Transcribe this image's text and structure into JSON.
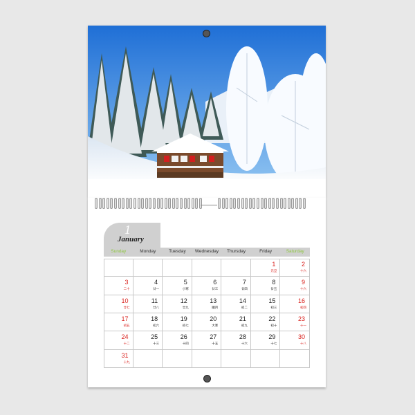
{
  "calendar": {
    "month_number": "1",
    "month_name": "January",
    "weekdays": [
      "Sunday",
      "Monday",
      "Tuesday",
      "Wednesday",
      "Thursday",
      "Friday",
      "Saturday"
    ],
    "weekend_color": "#8dc63f",
    "holiday_color": "#d9201c",
    "days": [
      {
        "n": "1",
        "l": "元旦",
        "red": true
      },
      {
        "n": "2",
        "l": "十六",
        "red": true
      },
      {
        "n": "3",
        "l": "二十",
        "red": true
      },
      {
        "n": "4",
        "l": "廿一",
        "red": false
      },
      {
        "n": "5",
        "l": "小寒",
        "red": false
      },
      {
        "n": "6",
        "l": "廿三",
        "red": false
      },
      {
        "n": "7",
        "l": "廿四",
        "red": false
      },
      {
        "n": "8",
        "l": "廿五",
        "red": false
      },
      {
        "n": "9",
        "l": "十六",
        "red": true
      },
      {
        "n": "10",
        "l": "廿七",
        "red": true
      },
      {
        "n": "11",
        "l": "廿八",
        "red": false
      },
      {
        "n": "12",
        "l": "廿九",
        "red": false
      },
      {
        "n": "13",
        "l": "臘月",
        "red": false
      },
      {
        "n": "14",
        "l": "初二",
        "red": false
      },
      {
        "n": "15",
        "l": "初三",
        "red": false
      },
      {
        "n": "16",
        "l": "初四",
        "red": true
      },
      {
        "n": "17",
        "l": "初五",
        "red": true
      },
      {
        "n": "18",
        "l": "初六",
        "red": false
      },
      {
        "n": "19",
        "l": "初七",
        "red": false
      },
      {
        "n": "20",
        "l": "大寒",
        "red": false
      },
      {
        "n": "21",
        "l": "初九",
        "red": false
      },
      {
        "n": "22",
        "l": "初十",
        "red": false
      },
      {
        "n": "23",
        "l": "十一",
        "red": true
      },
      {
        "n": "24",
        "l": "十二",
        "red": true
      },
      {
        "n": "25",
        "l": "十三",
        "red": false
      },
      {
        "n": "26",
        "l": "十四",
        "red": false
      },
      {
        "n": "27",
        "l": "十五",
        "red": false
      },
      {
        "n": "28",
        "l": "十六",
        "red": false
      },
      {
        "n": "29",
        "l": "十七",
        "red": false
      },
      {
        "n": "30",
        "l": "十八",
        "red": true
      },
      {
        "n": "31",
        "l": "十九",
        "red": true
      }
    ],
    "first_weekday_index": 5
  }
}
